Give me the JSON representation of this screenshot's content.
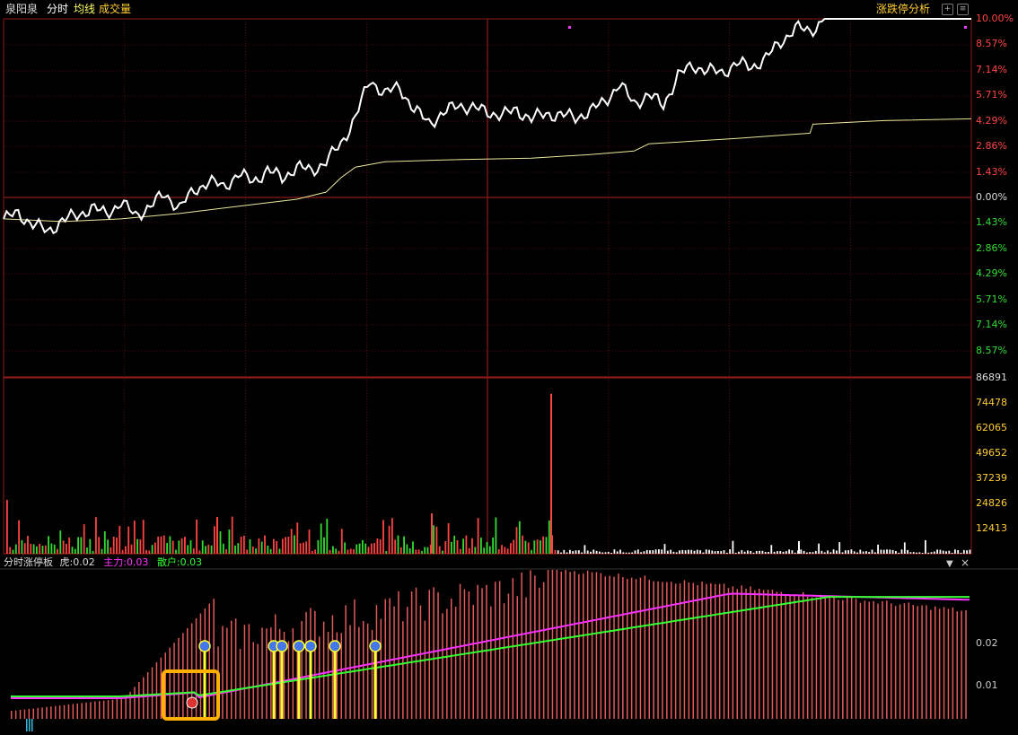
{
  "header": {
    "stock_name": "泉阳泉",
    "tab_timeshare": "分时",
    "tab_avg_line": "均线",
    "tab_volume": "成交量",
    "right_title": "涨跌停分析"
  },
  "indicator": {
    "title": "分时涨停板",
    "tiger_label": "虎:",
    "tiger_value": "0.02",
    "main_label": "主力:",
    "main_value": "0.03",
    "retail_label": "散户:",
    "retail_value": "0.03",
    "collapse_icon": "triangle-down-icon",
    "close_icon": "close-icon"
  },
  "colors": {
    "up": "#ff4444",
    "down": "#33dd33",
    "price_line": "#ffffff",
    "avg_line": "#e8e89a",
    "main_line": "#ff33ff",
    "retail_line": "#33ff33",
    "signal": "#ffff33",
    "highlight_box": "#ffb000",
    "grid": "#8b1a1a"
  },
  "chart_data": [
    {
      "type": "line",
      "name": "price",
      "y_ticks_up": [
        "10.00%",
        "8.57%",
        "7.14%",
        "5.71%",
        "4.29%",
        "2.86%",
        "1.43%"
      ],
      "y_zero": "0.00%",
      "y_ticks_down": [
        "1.43%",
        "2.86%",
        "4.29%",
        "5.71%",
        "7.14%",
        "8.57%"
      ],
      "ylim": [
        -10,
        10
      ],
      "series": [
        {
          "key": "price",
          "points": [
            [
              0,
              -1.2
            ],
            [
              5,
              -0.9
            ],
            [
              10,
              -1.5
            ],
            [
              15,
              -1.9
            ],
            [
              20,
              -1.3
            ],
            [
              25,
              -1.0
            ],
            [
              30,
              -0.6
            ],
            [
              35,
              -0.9
            ],
            [
              40,
              -0.3
            ],
            [
              45,
              -1.0
            ],
            [
              50,
              -0.5
            ],
            [
              55,
              0.2
            ],
            [
              60,
              -0.6
            ],
            [
              65,
              0.4
            ],
            [
              70,
              0.9
            ],
            [
              75,
              0.6
            ],
            [
              80,
              1.3
            ],
            [
              85,
              0.9
            ],
            [
              90,
              1.5
            ],
            [
              95,
              1.1
            ],
            [
              100,
              1.7
            ],
            [
              105,
              1.5
            ],
            [
              110,
              2.0
            ],
            [
              115,
              3.0
            ],
            [
              120,
              4.5
            ],
            [
              125,
              6.6
            ],
            [
              130,
              5.8
            ],
            [
              135,
              6.2
            ],
            [
              140,
              4.9
            ],
            [
              145,
              4.2
            ],
            [
              150,
              4.7
            ],
            [
              155,
              5.2
            ],
            [
              160,
              5.0
            ],
            [
              165,
              4.8
            ],
            [
              170,
              4.6
            ],
            [
              175,
              4.9
            ],
            [
              180,
              4.4
            ],
            [
              185,
              4.7
            ],
            [
              190,
              4.6
            ],
            [
              195,
              4.5
            ],
            [
              200,
              4.8
            ],
            [
              205,
              5.4
            ],
            [
              210,
              6.3
            ],
            [
              215,
              5.3
            ],
            [
              220,
              5.7
            ],
            [
              225,
              5.2
            ],
            [
              230,
              6.8
            ],
            [
              235,
              7.4
            ],
            [
              240,
              7.1
            ],
            [
              245,
              7.0
            ],
            [
              250,
              7.5
            ],
            [
              255,
              7.3
            ],
            [
              260,
              7.8
            ],
            [
              265,
              8.7
            ],
            [
              270,
              9.5
            ],
            [
              275,
              9.3
            ],
            [
              280,
              10.0
            ],
            [
              330,
              10.0
            ]
          ]
        },
        {
          "key": "avg",
          "points": [
            [
              0,
              -1.2
            ],
            [
              20,
              -1.35
            ],
            [
              40,
              -1.2
            ],
            [
              60,
              -0.9
            ],
            [
              80,
              -0.5
            ],
            [
              100,
              -0.1
            ],
            [
              110,
              0.3
            ],
            [
              115,
              1.1
            ],
            [
              120,
              1.7
            ],
            [
              130,
              2.0
            ],
            [
              150,
              2.1
            ],
            [
              180,
              2.2
            ],
            [
              200,
              2.4
            ],
            [
              215,
              2.6
            ],
            [
              220,
              3.0
            ],
            [
              250,
              3.3
            ],
            [
              275,
              3.6
            ],
            [
              276,
              4.1
            ],
            [
              300,
              4.3
            ],
            [
              330,
              4.4
            ]
          ]
        }
      ]
    },
    {
      "type": "bar",
      "name": "volume",
      "y_ticks": [
        "86891",
        "74478",
        "62065",
        "49652",
        "37239",
        "24826",
        "12413"
      ],
      "ylim": [
        0,
        86891
      ],
      "peak_value": 79000
    },
    {
      "type": "bar",
      "name": "limit-up-indicator",
      "y_ticks": [
        "0.02",
        "0.01"
      ],
      "ylim": [
        0,
        0.035
      ]
    }
  ]
}
